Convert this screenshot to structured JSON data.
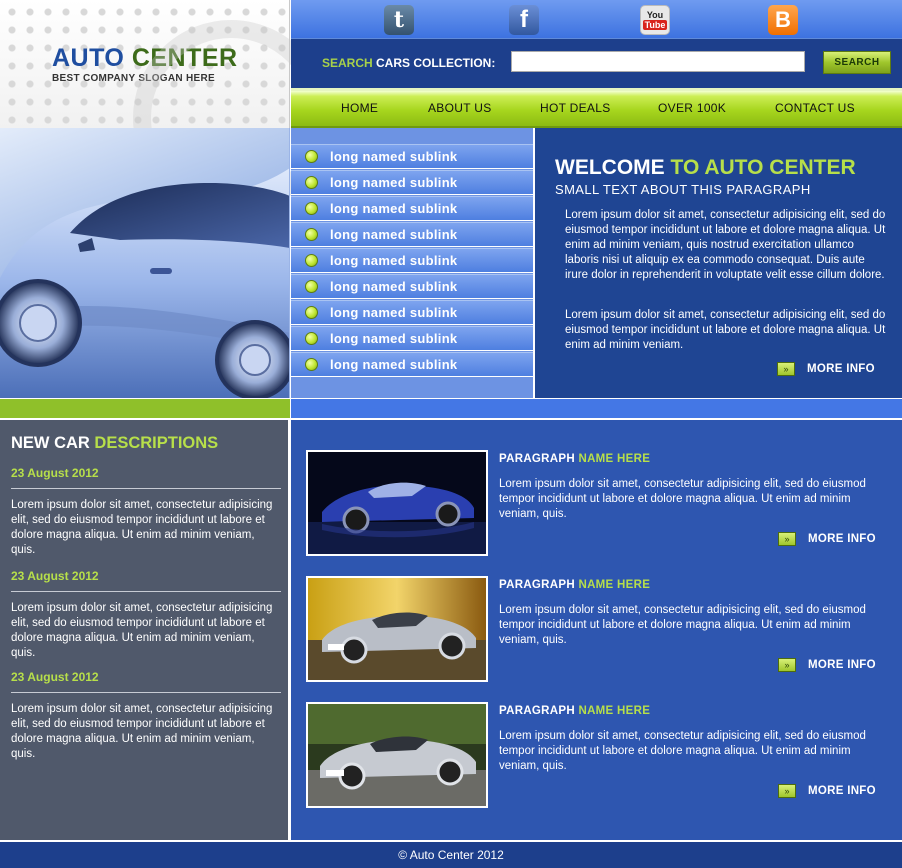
{
  "brand": {
    "title_main": "AUTO",
    "title_accent": "CENTER",
    "slogan": "BEST COMPANY SLOGAN HERE"
  },
  "social": [
    {
      "name": "tumblr-icon",
      "glyph": "t"
    },
    {
      "name": "facebook-icon",
      "glyph": "f"
    },
    {
      "name": "youtube-icon",
      "glyph_top": "You",
      "glyph_bottom": "Tube"
    },
    {
      "name": "blogger-icon",
      "glyph": "B"
    }
  ],
  "search": {
    "label_accent": "SEARCH",
    "label_rest": " CARS COLLECTION:",
    "value": "",
    "button": "SEARCH"
  },
  "nav": [
    "HOME",
    "ABOUT US",
    "HOT DEALS",
    "OVER 100K",
    "CONTACT US"
  ],
  "sublinks": [
    "long named sublink",
    "long named sublink",
    "long named sublink",
    "long named sublink",
    "long named sublink",
    "long named sublink",
    "long named sublink",
    "long named sublink",
    "long named sublink"
  ],
  "welcome": {
    "title_main": "WELCOME",
    "title_accent": " TO AUTO CENTER",
    "subtitle": "SMALL TEXT ABOUT THIS PARAGRAPH",
    "para1": "Lorem ipsum dolor sit amet, consectetur adipisicing elit, sed do eiusmod tempor incididunt ut labore et dolore magna aliqua. Ut enim ad minim veniam, quis nostrud exercitation ullamco laboris nisi ut aliquip ex ea commodo consequat. Duis aute irure dolor in reprehenderit in voluptate velit esse cillum dolore.",
    "para2": "Lorem ipsum dolor sit amet, consectetur adipisicing elit, sed do eiusmod tempor incididunt ut labore et dolore magna aliqua. Ut enim ad minim veniam.",
    "more": "MORE INFO",
    "more_arrow": "»"
  },
  "left": {
    "title_main": "NEW CAR ",
    "title_accent": "DESCRIPTIONS",
    "news": [
      {
        "date": "23 August 2012",
        "text": "Lorem ipsum dolor sit amet, consectetur adipisicing elit, sed do eiusmod tempor incididunt ut labore et dolore magna aliqua. Ut enim ad minim veniam, quis."
      },
      {
        "date": "23 August 2012",
        "text": "Lorem ipsum dolor sit amet, consectetur adipisicing elit, sed do eiusmod tempor incididunt ut labore et dolore magna aliqua. Ut enim ad minim veniam, quis."
      },
      {
        "date": "23 August 2012",
        "text": "Lorem ipsum dolor sit amet, consectetur adipisicing elit, sed do eiusmod tempor incididunt ut labore et dolore magna aliqua. Ut enim ad minim veniam, quis."
      }
    ]
  },
  "items": [
    {
      "title_main": "PARAGRAPH ",
      "title_accent": "NAME HERE",
      "text": "Lorem ipsum dolor sit amet, consectetur adipisicing elit, sed do eiusmod tempor incididunt ut labore et dolore magna aliqua. Ut enim ad minim veniam, quis.",
      "more": "MORE INFO"
    },
    {
      "title_main": "PARAGRAPH ",
      "title_accent": "NAME HERE",
      "text": "Lorem ipsum dolor sit amet, consectetur adipisicing elit, sed do eiusmod tempor incididunt ut labore et dolore magna aliqua. Ut enim ad minim veniam, quis.",
      "more": "MORE INFO"
    },
    {
      "title_main": "PARAGRAPH ",
      "title_accent": "NAME HERE",
      "text": "Lorem ipsum dolor sit amet, consectetur adipisicing elit, sed do eiusmod tempor incididunt ut labore et dolore magna aliqua. Ut enim ad minim veniam, quis.",
      "more": "MORE INFO"
    }
  ],
  "footer": "© Auto Center 2012",
  "colors": {
    "accent_green": "#b7df4a",
    "dark_blue": "#1d3f8c",
    "mid_blue": "#2e56b0",
    "slate": "#50596b"
  }
}
